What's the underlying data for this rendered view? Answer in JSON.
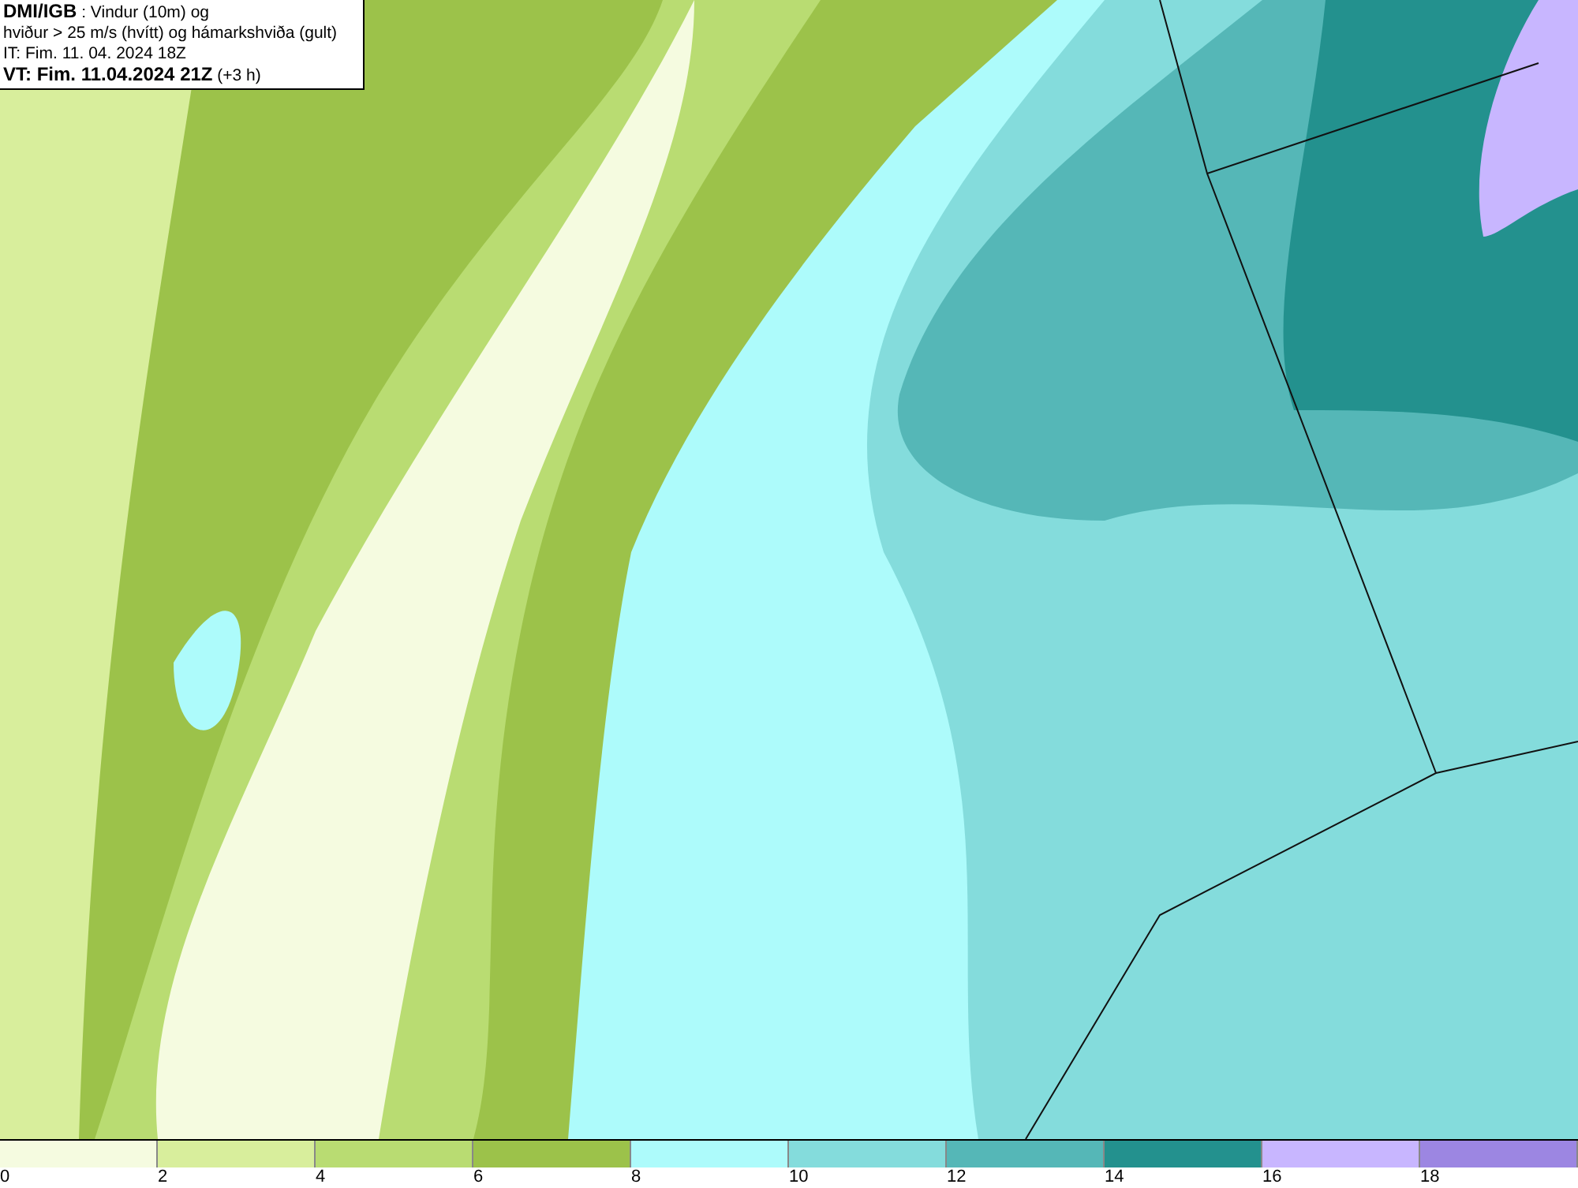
{
  "header": {
    "lines": [
      "**DMI/IGB** : Vindur (10m) og",
      "hviður > 25 m/s (hvítt) og hámarkshviða (gult)",
      "IT: Fim. 11. 04. 2024 18Z",
      "**VT: Fim. 11.04.2024 21Z** (+3 h)"
    ]
  },
  "legend": [
    {
      "label": "0",
      "color": "#f5fbe0"
    },
    {
      "label": "2",
      "color": "#d8ee9c"
    },
    {
      "label": "4",
      "color": "#b9dc72"
    },
    {
      "label": "6",
      "color": "#9cc24a"
    },
    {
      "label": "8",
      "color": "#adfbfb"
    },
    {
      "label": "10",
      "color": "#84dcdc"
    },
    {
      "label": "12",
      "color": "#55b7b7"
    },
    {
      "label": "14",
      "color": "#23918e"
    },
    {
      "label": "16",
      "color": "#c8b6ff"
    },
    {
      "label": "18",
      "color": "#9c86e2"
    }
  ]
}
